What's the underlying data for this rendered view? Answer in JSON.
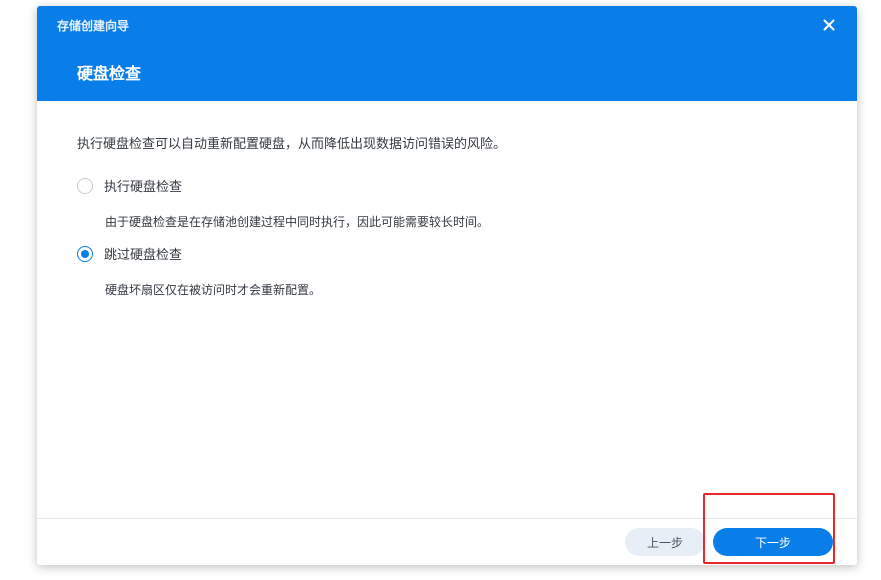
{
  "window": {
    "title": "存储创建向导",
    "close_icon": "close-icon"
  },
  "header": {
    "heading": "硬盘检查"
  },
  "content": {
    "intro": "执行硬盘检查可以自动重新配置硬盘，从而降低出现数据访问错误的风险。",
    "options": [
      {
        "label": "执行硬盘检查",
        "description": "由于硬盘检查是在存储池创建过程中同时执行，因此可能需要较长时间。",
        "checked": false
      },
      {
        "label": "跳过硬盘检查",
        "description": "硬盘坏扇区仅在被访问时才会重新配置。",
        "checked": true
      }
    ]
  },
  "footer": {
    "back_label": "上一步",
    "next_label": "下一步"
  },
  "colors": {
    "accent": "#0a7ee8",
    "highlight": "#e8262b"
  }
}
